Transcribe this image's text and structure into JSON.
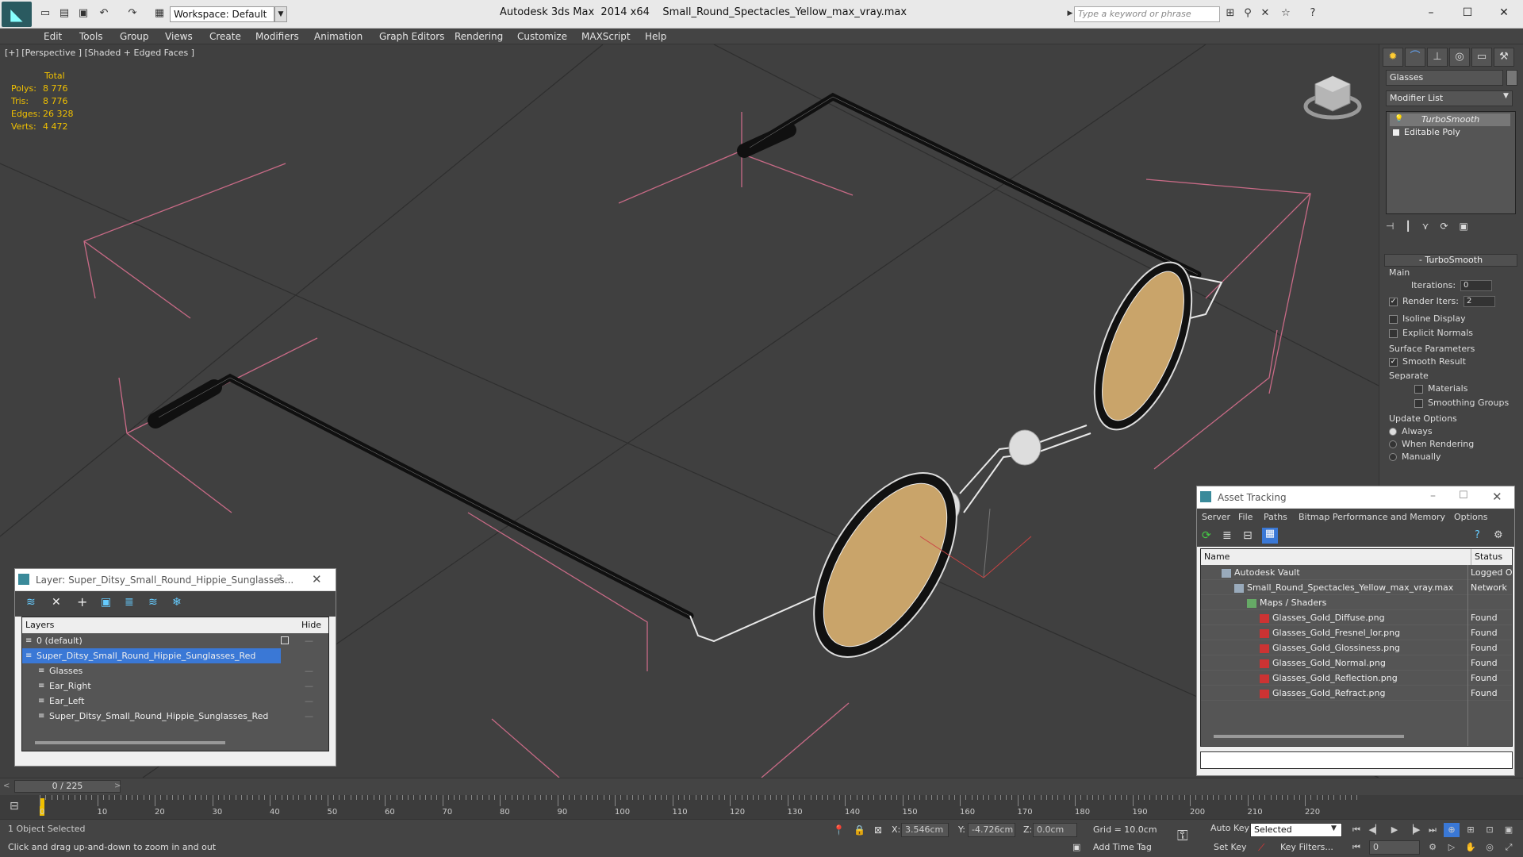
{
  "titlebar": {
    "app_title": "Autodesk 3ds Max  2014 x64",
    "file_name": "Small_Round_Spectacles_Yellow_max_vray.max",
    "workspace": "Workspace: Default",
    "search_placeholder": "Type a keyword or phrase"
  },
  "menu": [
    "Edit",
    "Tools",
    "Group",
    "Views",
    "Create",
    "Modifiers",
    "Animation",
    "Graph Editors",
    "Rendering",
    "Customize",
    "MAXScript",
    "Help"
  ],
  "viewport": {
    "label": "[+] [Perspective ] [Shaded + Edged Faces ]",
    "stats": {
      "total": "Total",
      "polys_label": "Polys:",
      "polys": "8 776",
      "tris_label": "Tris:",
      "tris": "8 776",
      "edges_label": "Edges:",
      "edges": "26 328",
      "verts_label": "Verts:",
      "verts": "4 472"
    }
  },
  "command_panel": {
    "object_name": "Glasses",
    "modifier_list": "Modifier List",
    "stack": [
      "TurboSmooth",
      "Editable Poly"
    ],
    "rollout_title": "TurboSmooth",
    "main_label": "Main",
    "iterations_label": "Iterations:",
    "iterations": "0",
    "render_iters_label": "Render Iters:",
    "render_iters": "2",
    "isoline": "Isoline Display",
    "explicit_normals": "Explicit Normals",
    "surface_params": "Surface Parameters",
    "smooth_result": "Smooth Result",
    "separate": "Separate",
    "materials": "Materials",
    "smoothing_groups": "Smoothing Groups",
    "update_options": "Update Options",
    "always": "Always",
    "when_rendering": "When Rendering",
    "manually": "Manually"
  },
  "layers_window": {
    "title": "Layer: Super_Ditsy_Small_Round_Hippie_Sunglasses...",
    "help": "?",
    "col_layers": "Layers",
    "col_hide": "Hide",
    "rows": [
      {
        "name": "0 (default)",
        "indent": 0
      },
      {
        "name": "Super_Ditsy_Small_Round_Hippie_Sunglasses_Red",
        "indent": 0,
        "selected": true
      },
      {
        "name": "Glasses",
        "indent": 1
      },
      {
        "name": "Ear_Right",
        "indent": 1
      },
      {
        "name": "Ear_Left",
        "indent": 1
      },
      {
        "name": "Super_Ditsy_Small_Round_Hippie_Sunglasses_Red",
        "indent": 1
      }
    ]
  },
  "asset_window": {
    "title": "Asset Tracking",
    "menu": [
      "Server",
      "File",
      "Paths",
      "Bitmap Performance and Memory",
      "Options"
    ],
    "col_name": "Name",
    "col_status": "Status",
    "rows": [
      {
        "name": "Autodesk Vault",
        "status": "Logged O",
        "indent": 1
      },
      {
        "name": "Small_Round_Spectacles_Yellow_max_vray.max",
        "status": "Network",
        "indent": 2
      },
      {
        "name": "Maps / Shaders",
        "status": "",
        "indent": 3
      },
      {
        "name": "Glasses_Gold_Diffuse.png",
        "status": "Found",
        "indent": 4
      },
      {
        "name": "Glasses_Gold_Fresnel_Ior.png",
        "status": "Found",
        "indent": 4
      },
      {
        "name": "Glasses_Gold_Glossiness.png",
        "status": "Found",
        "indent": 4
      },
      {
        "name": "Glasses_Gold_Normal.png",
        "status": "Found",
        "indent": 4
      },
      {
        "name": "Glasses_Gold_Reflection.png",
        "status": "Found",
        "indent": 4
      },
      {
        "name": "Glasses_Gold_Refract.png",
        "status": "Found",
        "indent": 4
      }
    ]
  },
  "timeline": {
    "frame": "0 / 225",
    "ticks": [
      "0",
      "10",
      "20",
      "30",
      "40",
      "50",
      "60",
      "70",
      "80",
      "90",
      "100",
      "110",
      "120",
      "130",
      "140",
      "150",
      "160",
      "170",
      "180",
      "190",
      "200",
      "210",
      "220"
    ]
  },
  "status": {
    "selected": "1 Object Selected",
    "hint": "Click and drag up-and-down to zoom in and out",
    "x_label": "X:",
    "x": "3.546cm",
    "y_label": "Y:",
    "y": "-4.726cm",
    "z_label": "Z:",
    "z": "0.0cm",
    "grid": "Grid = 10.0cm",
    "add_time_tag": "Add Time Tag",
    "auto_key": "Auto Key",
    "set_key": "Set Key",
    "key_mode": "Selected",
    "key_filters": "Key Filters...",
    "frame_field": "0"
  },
  "colors": {
    "selection": "#3a78d6",
    "stats": "#f0c000",
    "lens": "#c9a46a"
  }
}
